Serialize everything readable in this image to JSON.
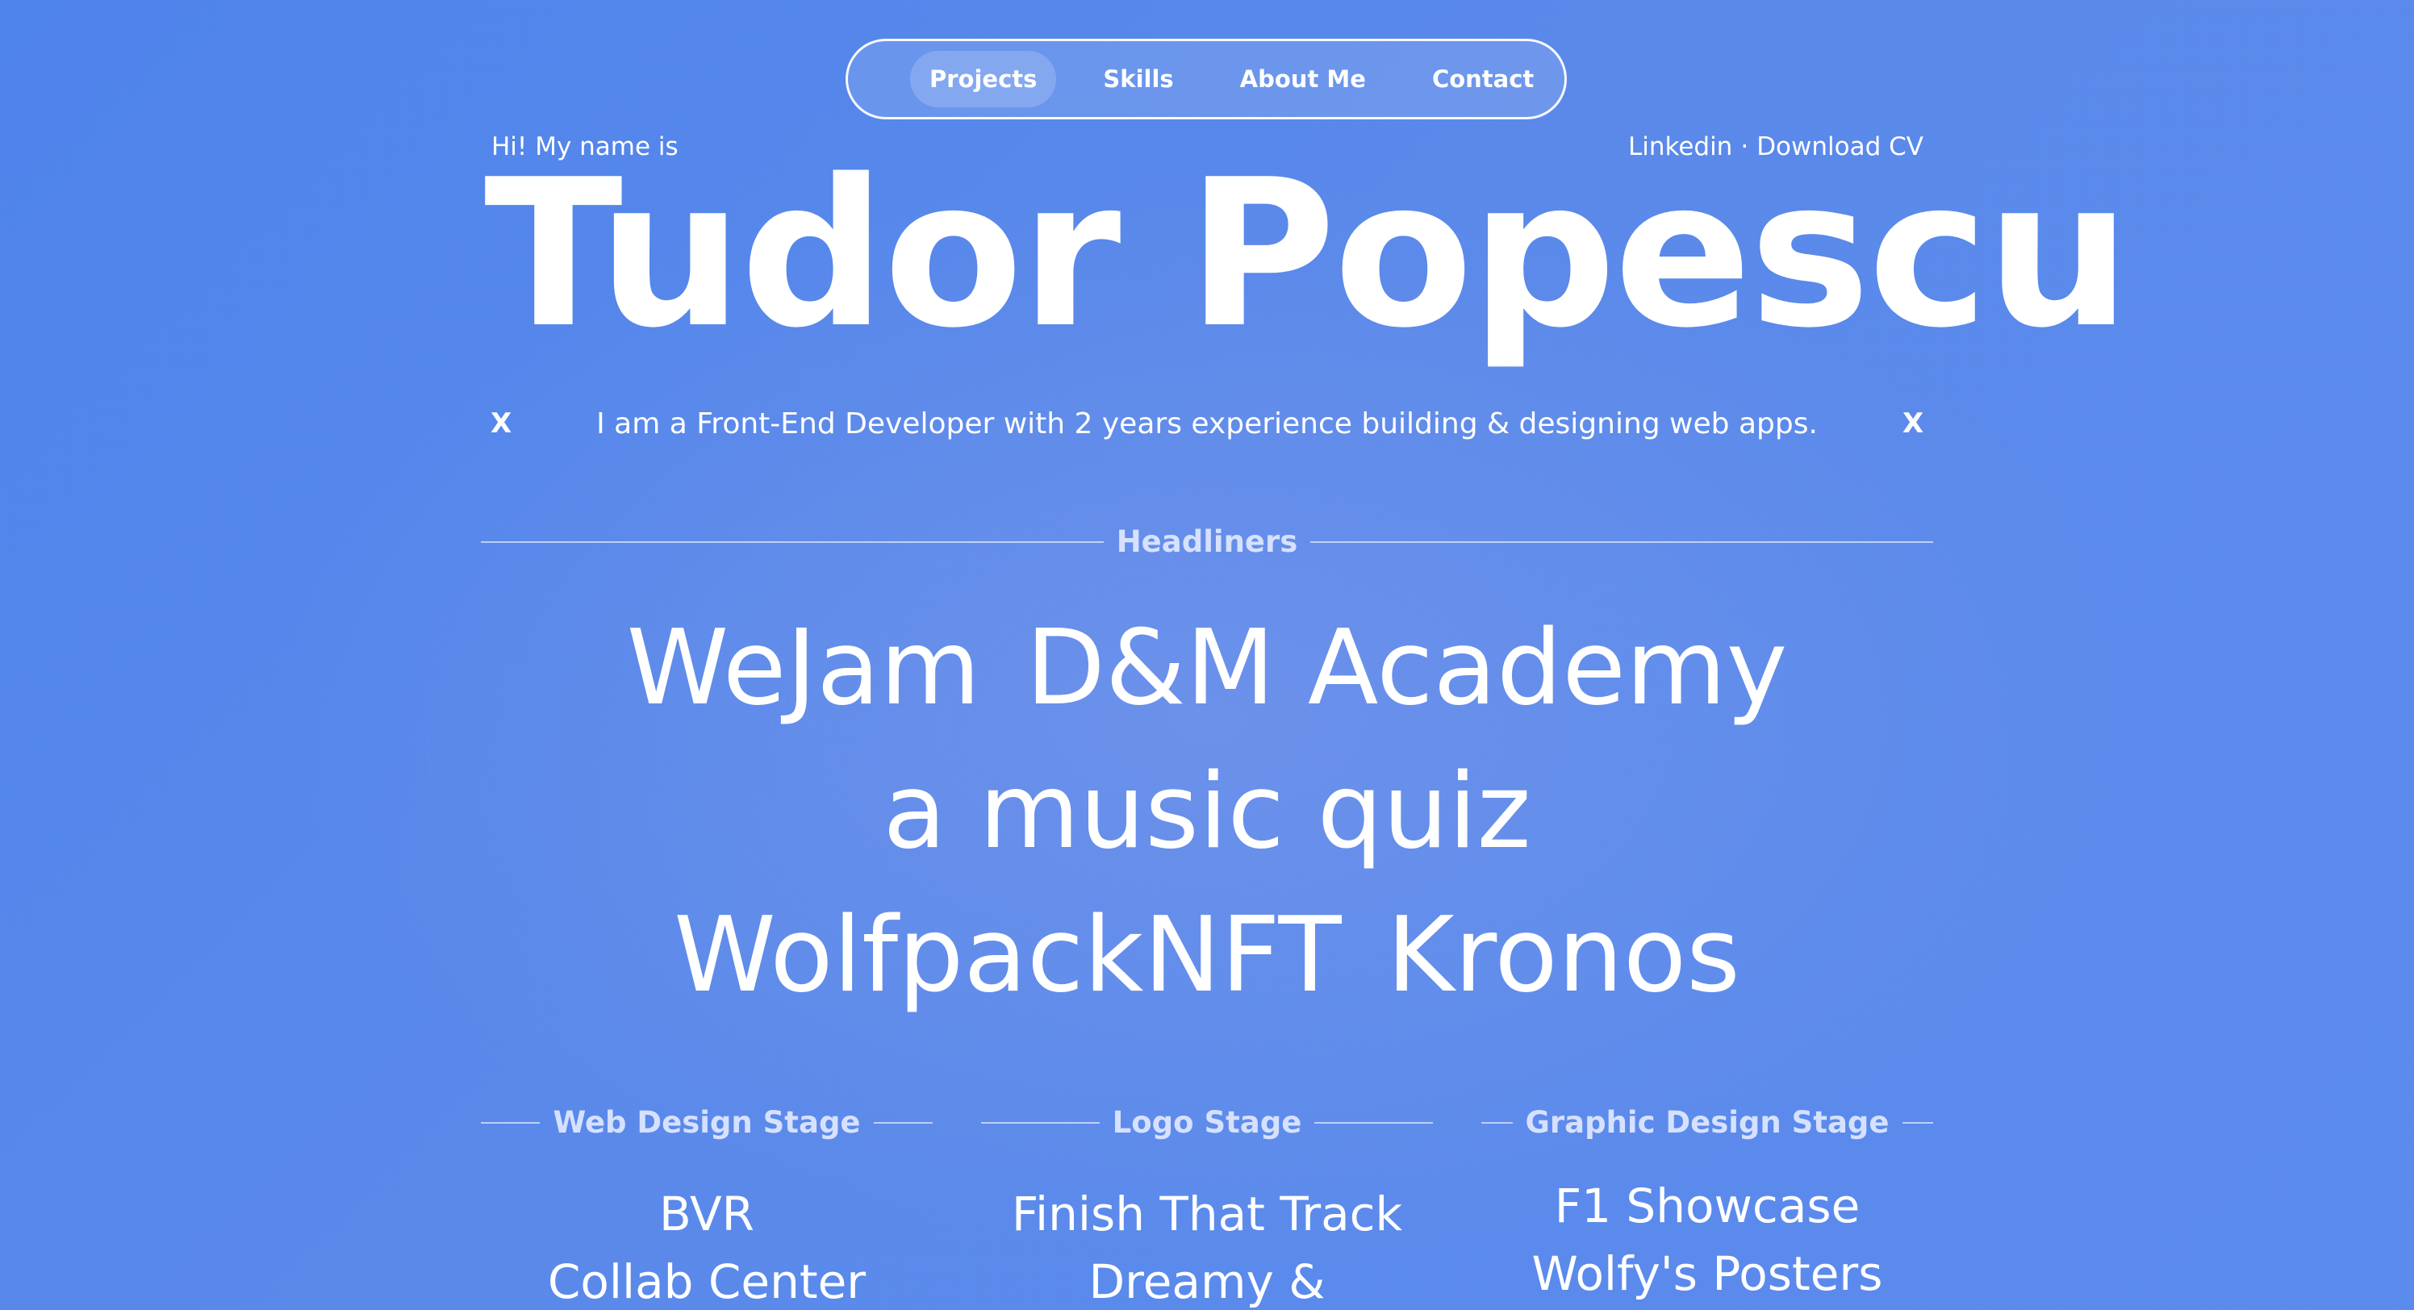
{
  "nav": {
    "items": [
      {
        "label": "Projects",
        "active": true
      },
      {
        "label": "Skills",
        "active": false
      },
      {
        "label": "About Me",
        "active": false
      },
      {
        "label": "Contact",
        "active": false
      }
    ]
  },
  "intro": {
    "greeting": "Hi! My name is",
    "links": {
      "linkedin": "Linkedin",
      "separator": "·",
      "cv": "Download CV"
    },
    "name": "Tudor Popescu",
    "tagline": "I am a Front-End Developer with 2 years experience building & designing web apps.",
    "mark_left": "X",
    "mark_right": "X"
  },
  "headliners": {
    "title": "Headliners",
    "rows": [
      [
        "WeJam",
        "D&M Academy"
      ],
      [
        "a music quiz"
      ],
      [
        "WolfpackNFT",
        "Kronos"
      ]
    ]
  },
  "stages": [
    {
      "title": "Web Design Stage",
      "items": [
        "BVR",
        "Collab Center"
      ]
    },
    {
      "title": "Logo Stage",
      "items": [
        "Finish That Track",
        "Dreamy &"
      ]
    },
    {
      "title": "Graphic Design Stage",
      "items": [
        "F1 Showcase",
        "Wolfy's Posters"
      ]
    }
  ],
  "colors": {
    "background": "#5588ec",
    "text": "#ffffff"
  }
}
